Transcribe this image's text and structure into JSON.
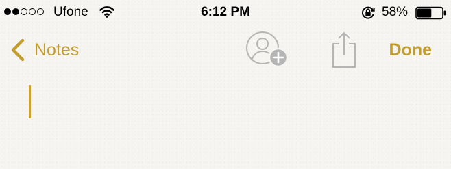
{
  "status_bar": {
    "signal_bars_filled": 2,
    "signal_bars_total": 5,
    "carrier": "Ufone",
    "wifi_icon": "wifi-icon",
    "time": "6:12 PM",
    "rotation_lock_icon": "rotation-lock-icon",
    "battery_percent": "58%",
    "battery_level": 0.58
  },
  "nav_bar": {
    "back_label": "Notes",
    "back_icon": "chevron-left-icon",
    "add_person_icon": "add-person-icon",
    "share_icon": "share-icon",
    "done_label": "Done"
  },
  "note": {
    "text": ""
  },
  "colors": {
    "accent": "#c29d2c",
    "cursor": "#c9a23a",
    "background": "#f6f5f2",
    "disabled_icon": "#b5b5b5"
  }
}
